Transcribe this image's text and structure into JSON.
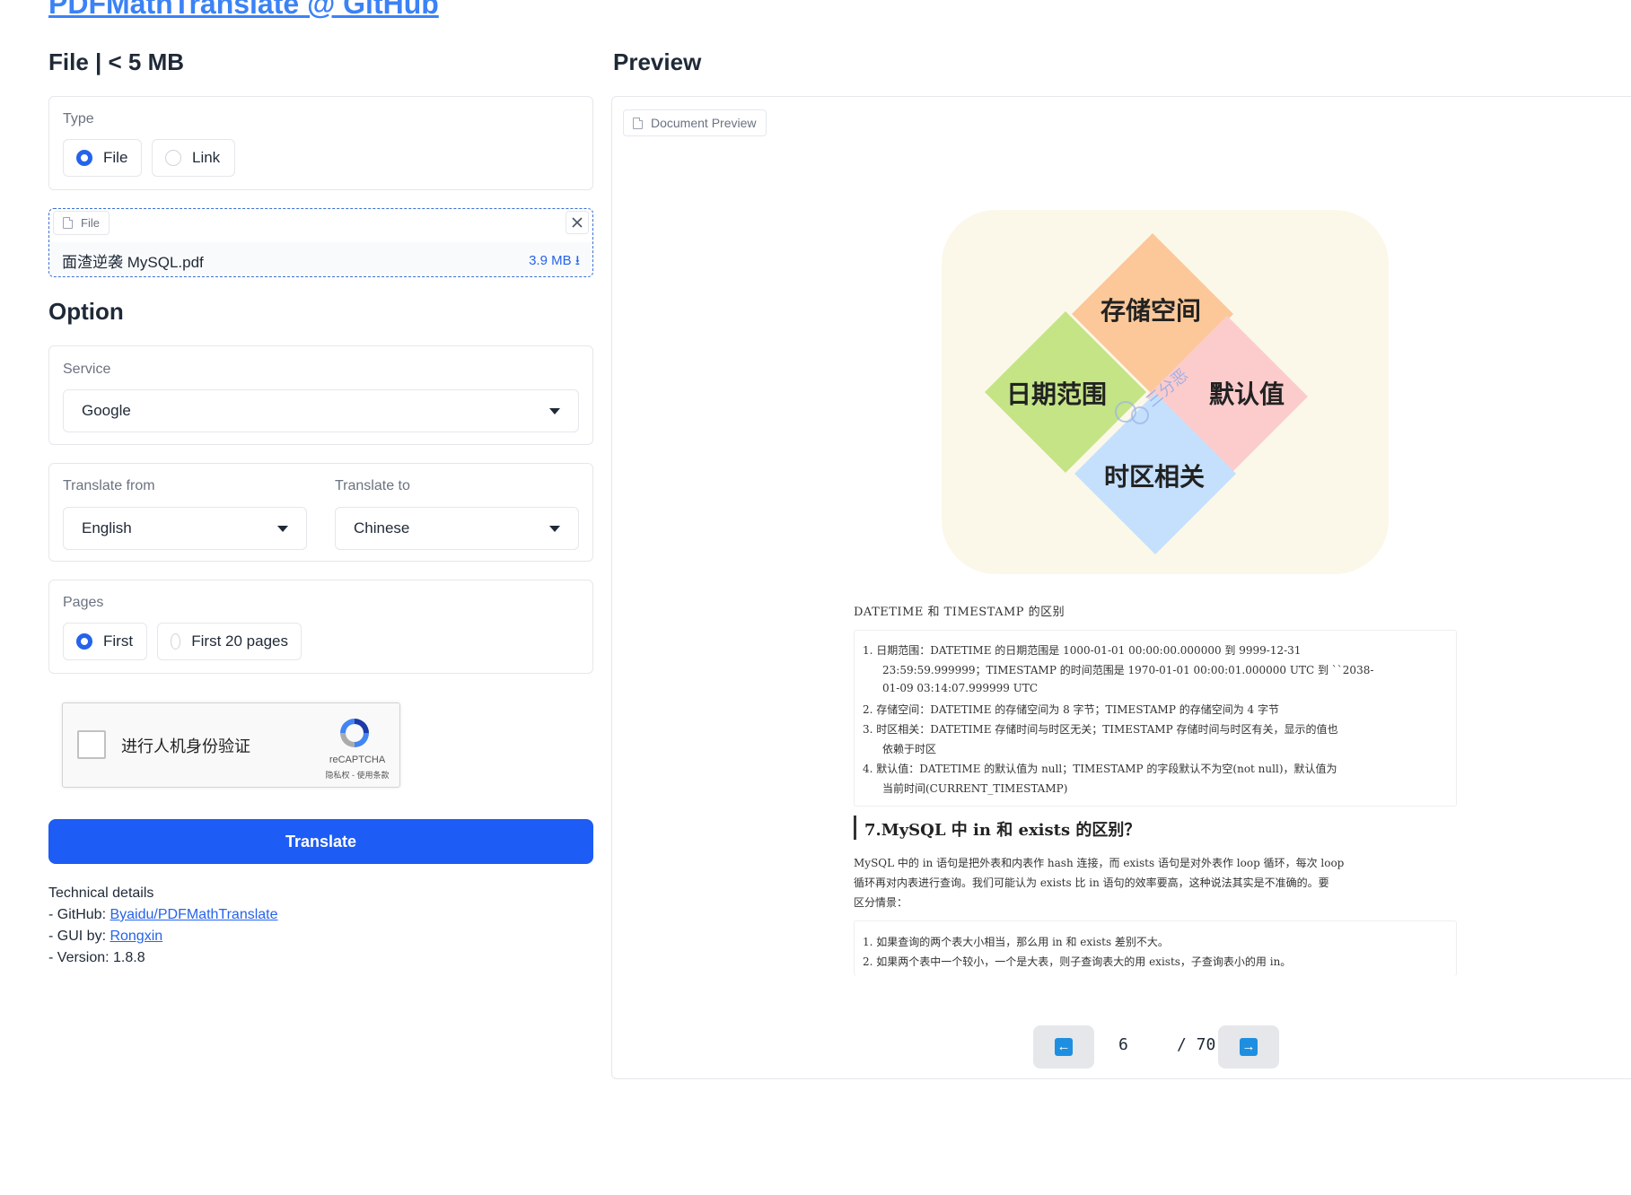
{
  "header": {
    "title_link": "PDFMathTranslate @ GitHub"
  },
  "file_section": {
    "heading": "File | < 5 MB",
    "type_label": "Type",
    "type_options": [
      "File",
      "Link"
    ],
    "type_selected": "File",
    "file_tag": "File",
    "file_name": "面渣逆袭 MySQL.pdf",
    "file_size": "3.9 MB ⭳"
  },
  "option_section": {
    "heading": "Option",
    "service_label": "Service",
    "service_value": "Google",
    "from_label": "Translate from",
    "from_value": "English",
    "to_label": "Translate to",
    "to_value": "Chinese",
    "pages_label": "Pages",
    "pages_options": [
      "First",
      "First 20 pages"
    ],
    "pages_selected": "First"
  },
  "recaptcha": {
    "label": "进行人机身份验证",
    "brand": "reCAPTCHA",
    "links": "隐私权 - 使用条款"
  },
  "translate_button": "Translate",
  "tech": {
    "title": "Technical details",
    "github_prefix": "- GitHub: ",
    "github_link": "Byaidu/PDFMathTranslate",
    "gui_prefix": "- GUI by: ",
    "gui_link": "Rongxin",
    "version": "- Version: 1.8.8"
  },
  "preview": {
    "heading": "Preview",
    "tag": "Document Preview",
    "diagram": {
      "top": "存储空间",
      "left": "日期范围",
      "right": "默认值",
      "bottom": "时区相关",
      "watermark": "三分恶",
      "colors": {
        "bg": "#fbf8ea",
        "top": "#fcc899",
        "left": "#c4e486",
        "right": "#fccccc",
        "bottom": "#c5e0fc"
      }
    },
    "doc": {
      "subtitle": "DATETIME 和 TIMESTAMP 的区别",
      "list1": [
        "1. 日期范围：DATETIME 的日期范围是 1000-01-01 00:00:00.000000 到 9999-12-31",
        "23:59:59.999999；TIMESTAMP 的时间范围是 1970-01-01 00:00:01.000000 UTC 到 ``2038-",
        "01-09 03:14:07.999999 UTC",
        "2. 存储空间：DATETIME 的存储空间为 8 字节；TIMESTAMP 的存储空间为 4 字节",
        "3. 时区相关：DATETIME 存储时间与时区无关；TIMESTAMP 存储时间与时区有关，显示的值也",
        "依赖于时区",
        "4. 默认值：DATETIME 的默认值为 null；TIMESTAMP 的字段默认不为空(not null)，默认值为",
        "当前时间(CURRENT_TIMESTAMP)"
      ],
      "heading2": "7.MySQL 中 in 和 exists 的区别？",
      "para": [
        "MySQL 中的 in 语句是把外表和内表作 hash 连接，而 exists 语句是对外表作 loop 循环，每次 loop",
        "循环再对内表进行查询。我们可能认为 exists 比 in 语句的效率要高，这种说法其实是不准确的。要",
        "区分情景："
      ],
      "list2": [
        "1. 如果查询的两个表大小相当，那么用 in 和 exists 差别不大。",
        "2. 如果两个表中一个较小，一个是大表，则子查询表大的用 exists，子查询表小的用 in。"
      ]
    },
    "pager": {
      "current": "6",
      "total": "/ 70",
      "prev_icon": "arrow-left-icon",
      "next_icon": "arrow-right-icon"
    }
  },
  "colors": {
    "accent": "#1d5cf5",
    "link": "#3b82f6"
  }
}
